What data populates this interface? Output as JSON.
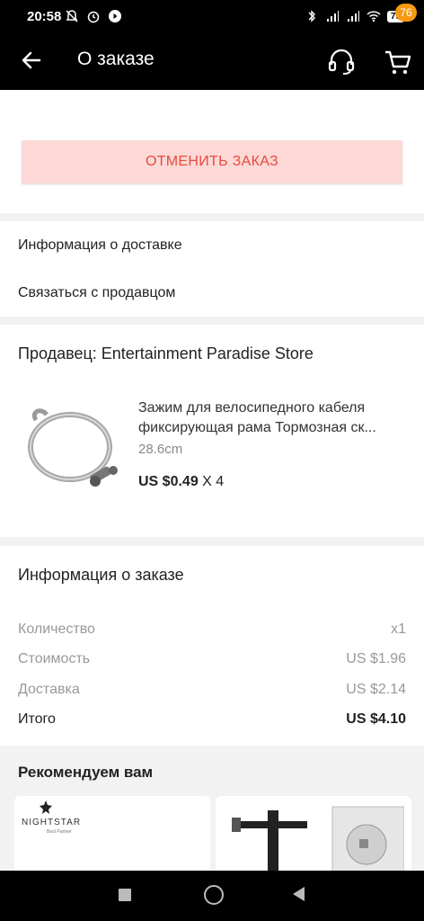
{
  "status_bar": {
    "time": "20:58",
    "battery": "79"
  },
  "app_bar": {
    "title": "О заказе",
    "cart_count": "76"
  },
  "cancel_button": {
    "label": "ОТМЕНИТЬ ЗАКАЗ"
  },
  "menu": {
    "delivery_info": "Информация о доставке",
    "contact_seller": "Связаться с продавцом"
  },
  "seller": {
    "name_label": "Продавец: Entertainment Paradise Store",
    "product": {
      "title_line1": "Зажим для велосипедного кабеля",
      "title_line2": "фиксирующая рама Тормозная ск...",
      "variant": "28.6cm",
      "price": "US $0.49",
      "qty": " X 4"
    }
  },
  "order_info": {
    "title": "Информация о заказе",
    "rows": [
      {
        "label": "Количество",
        "value": "x1"
      },
      {
        "label": "Стоимость",
        "value": "US $1.96"
      },
      {
        "label": "Доставка",
        "value": "US $2.14"
      },
      {
        "label": "Итого",
        "value": "US $4.10"
      }
    ]
  },
  "recommend": {
    "title": "Рекомендуем вам",
    "card1_brand": "NIGHTSTAR",
    "card1_sub": "Best Partner"
  },
  "colors": {
    "accent": "#e84a3f",
    "cancel_bg": "#fcd9d6",
    "badge": "#f79a12"
  }
}
